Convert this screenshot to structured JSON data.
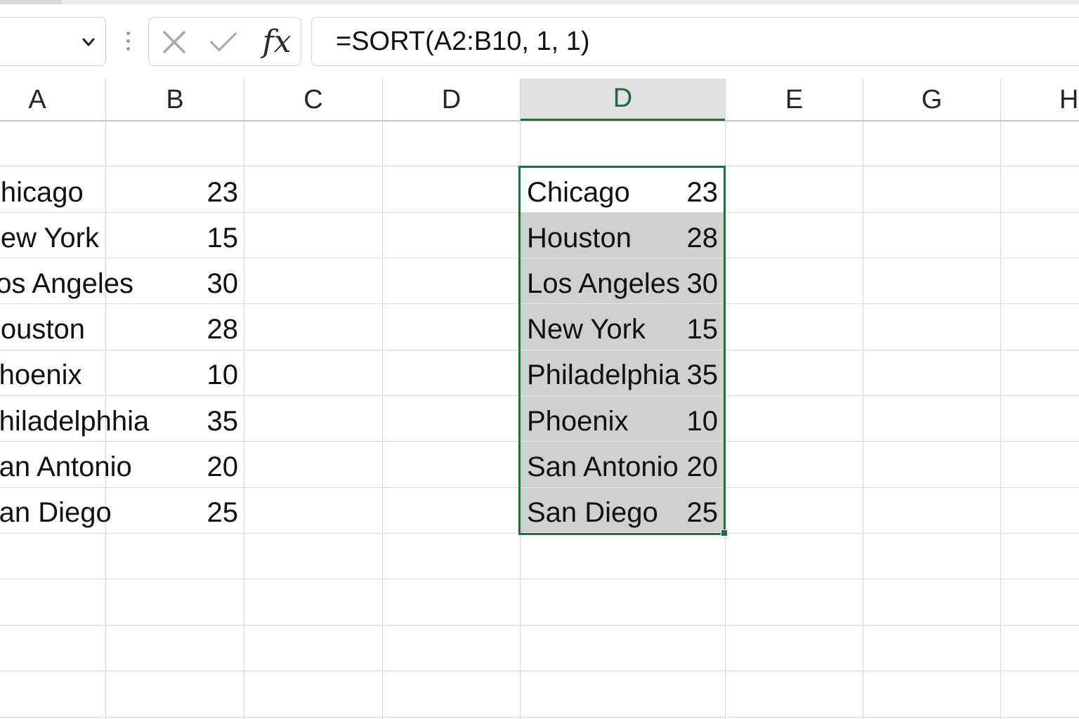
{
  "formula_bar": {
    "namebox_value": "",
    "cancel_icon": "x-icon",
    "enter_icon": "check-icon",
    "fx_label": "fx",
    "formula": "=SORT(A2:B10, 1, 1)"
  },
  "columns": [
    {
      "label": "A",
      "selected": false
    },
    {
      "label": "B",
      "selected": false
    },
    {
      "label": "C",
      "selected": false
    },
    {
      "label": "D",
      "selected": false
    },
    {
      "label": "D",
      "selected": true
    },
    {
      "label": "E",
      "selected": false
    },
    {
      "label": "G",
      "selected": false
    },
    {
      "label": "H",
      "selected": false
    }
  ],
  "source_rows": [
    {
      "city": "Chicago",
      "value": "23"
    },
    {
      "city": "New York",
      "value": "15"
    },
    {
      "city": "Los Angeles",
      "value": "30"
    },
    {
      "city": "Houston",
      "value": "28"
    },
    {
      "city": "Phoenix",
      "value": "10"
    },
    {
      "city": "Philadelphhia",
      "value": "35"
    },
    {
      "city": "San Antonio",
      "value": "20"
    },
    {
      "city": "San Diego",
      "value": "25"
    }
  ],
  "sorted_rows": [
    {
      "city": "Chicago",
      "value": "23"
    },
    {
      "city": "Houston",
      "value": "28"
    },
    {
      "city": "Los Angeles",
      "value": "30"
    },
    {
      "city": "New York",
      "value": "15"
    },
    {
      "city": "Philadelphia",
      "value": "35"
    },
    {
      "city": "Phoenix",
      "value": "10"
    },
    {
      "city": "San Antonio",
      "value": "20"
    },
    {
      "city": "San Diego",
      "value": "25"
    }
  ],
  "colors": {
    "selection": "#1f6e3f",
    "spill_fill": "#d0d0d0",
    "header_selected": "#e1e1e1"
  }
}
